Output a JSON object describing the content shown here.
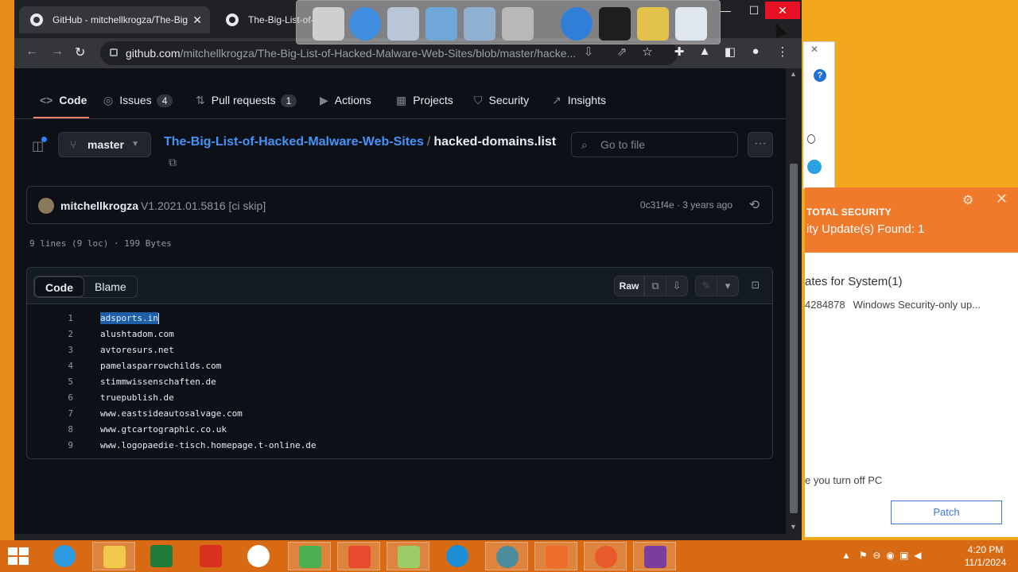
{
  "browser": {
    "tabs": [
      {
        "label": "GitHub - mitchellkrogza/The-Big"
      },
      {
        "label": "The-Big-List-of-Ha"
      }
    ],
    "url_host": "github.com",
    "url_path": "/mitchellkrogza/The-Big-List-of-Hacked-Malware-Web-Sites/blob/master/hacke..."
  },
  "repo_nav": {
    "code": "Code",
    "issues": "Issues",
    "issues_count": "4",
    "pulls": "Pull requests",
    "pulls_count": "1",
    "actions": "Actions",
    "projects": "Projects",
    "security": "Security",
    "insights": "Insights"
  },
  "file_header": {
    "branch": "master",
    "repo": "The-Big-List-of-Hacked-Malware-Web-Sites",
    "separator": "/",
    "file": "hacked-domains.list",
    "goto_placeholder": "Go to file"
  },
  "commit": {
    "author": "mitchellkrogza",
    "message": "V1.2021.01.5816 [ci skip]",
    "meta": "0c31f4e · 3 years ago"
  },
  "file_info": "9 lines (9 loc) · 199 Bytes",
  "file_view": {
    "code_tab": "Code",
    "blame_tab": "Blame",
    "raw": "Raw"
  },
  "lines": [
    {
      "n": "1",
      "text": "adsports.in"
    },
    {
      "n": "2",
      "text": "alushtadom.com"
    },
    {
      "n": "3",
      "text": "avtoresurs.net"
    },
    {
      "n": "4",
      "text": "pamelasparrowchilds.com"
    },
    {
      "n": "5",
      "text": "stimmwissenschaften.de"
    },
    {
      "n": "6",
      "text": "truepublish.de"
    },
    {
      "n": "7",
      "text": "www.eastsideautosalvage.com"
    },
    {
      "n": "8",
      "text": "www.gtcartographic.co.uk"
    },
    {
      "n": "9",
      "text": "www.logopaedie-tisch.homepage.t-online.de"
    }
  ],
  "security_popup": {
    "brand": "TOTAL SECURITY",
    "title": "ity Update(s) Found: 1",
    "subtitle": "ates for System(1)",
    "kb": "4284878",
    "kb_desc": "Windows Security-only up...",
    "note": "e you turn off PC",
    "patch_button": "Patch"
  },
  "clock": {
    "time": "4:20 PM",
    "date": "11/1/2024"
  },
  "colors": {
    "accent": "#f78166",
    "link": "#4493f8",
    "taskbar": "#d86a14",
    "popup": "#f07a2b"
  }
}
